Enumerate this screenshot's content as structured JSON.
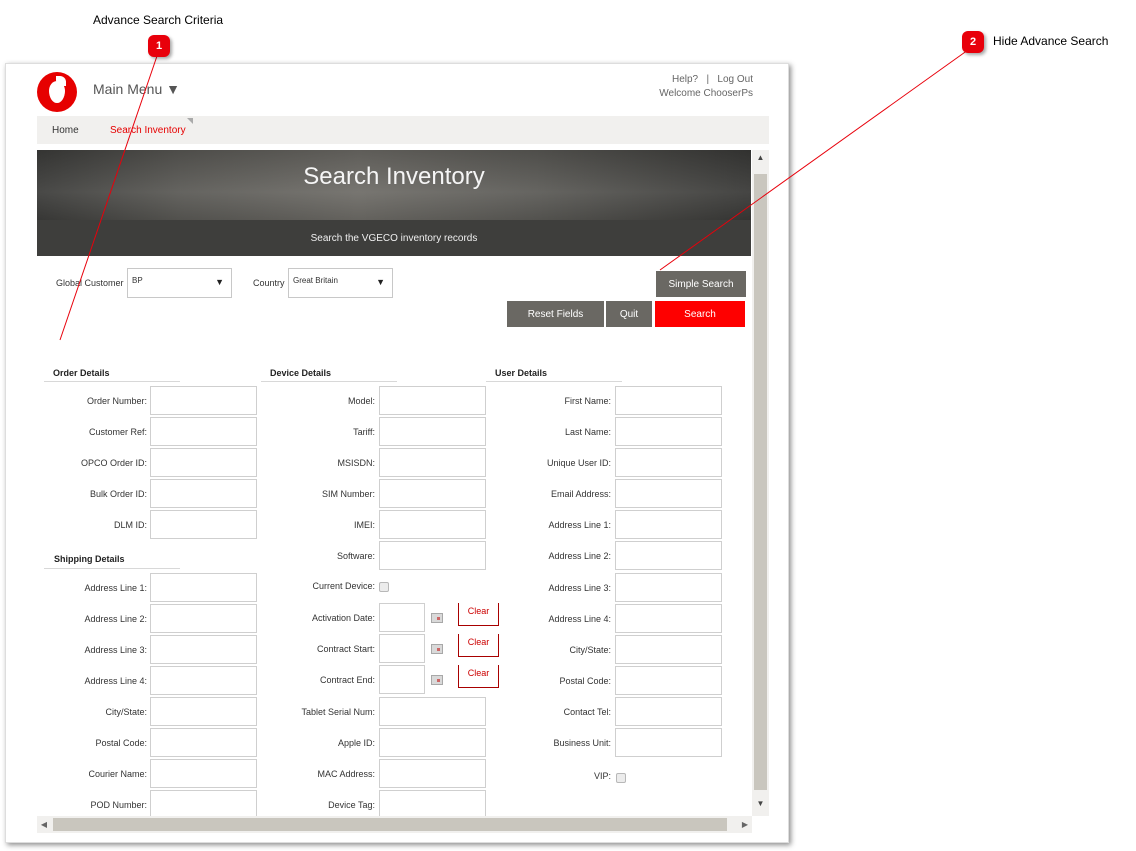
{
  "annotations": [
    {
      "number": "1",
      "label": "Advance Search Criteria"
    },
    {
      "number": "2",
      "label": "Hide Advance Search"
    }
  ],
  "header": {
    "main_menu": "Main Menu ▼",
    "help": "Help?",
    "separator": "|",
    "logout": "Log Out",
    "welcome": "Welcome ChooserPs"
  },
  "breadcrumb": {
    "home": "Home",
    "current": "Search Inventory"
  },
  "hero": {
    "title": "Search Inventory",
    "subtitle": "Search the VGECO inventory records"
  },
  "filters": {
    "global_customer_label": "Global Customer",
    "global_customer_value": "BP",
    "country_label": "Country",
    "country_value": "Great Britain",
    "dropdown_arrow": "▼"
  },
  "buttons": {
    "simple_search": "Simple Search",
    "reset_fields": "Reset Fields",
    "quit": "Quit",
    "search": "Search",
    "clear": "Clear"
  },
  "sections": {
    "order": {
      "title": "Order Details",
      "fields": [
        "Order Number:",
        "Customer Ref:",
        "OPCO Order ID:",
        "Bulk Order ID:",
        "DLM ID:"
      ]
    },
    "shipping": {
      "title": "Shipping Details",
      "fields": [
        "Address Line 1:",
        "Address Line 2:",
        "Address Line 3:",
        "Address Line 4:",
        "City/State:",
        "Postal Code:",
        "Courier Name:",
        "POD Number:"
      ]
    },
    "device": {
      "title": "Device Details",
      "fields": [
        "Model:",
        "Tariff:",
        "MSISDN:",
        "SIM Number:",
        "IMEI:",
        "Software:"
      ],
      "current_device": "Current Device:",
      "date_fields": [
        "Activation Date:",
        "Contract Start:",
        "Contract End:"
      ],
      "more_fields": [
        "Tablet Serial Num:",
        "Apple ID:",
        "MAC Address:",
        "Device Tag:"
      ]
    },
    "user": {
      "title": "User Details",
      "fields": [
        "First Name:",
        "Last Name:",
        "Unique User ID:",
        "Email Address:",
        "Address Line 1:",
        "Address Line 2:",
        "Address Line 3:",
        "Address Line 4:",
        "City/State:",
        "Postal Code:",
        "Contact Tel:",
        "Business Unit:"
      ],
      "vip": "VIP:"
    }
  },
  "scroll": {
    "up": "▲",
    "down": "▼",
    "left": "◀",
    "right": "▶"
  }
}
